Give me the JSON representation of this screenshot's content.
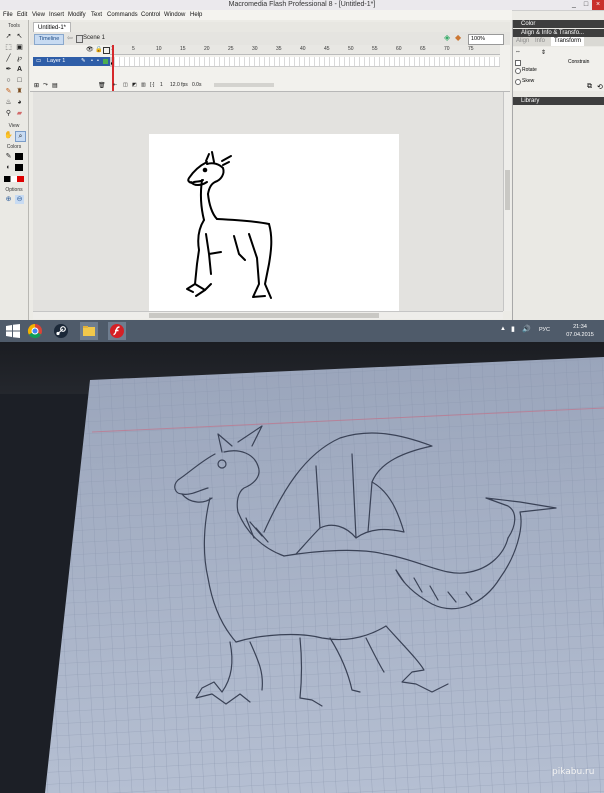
{
  "window": {
    "title": "Macromedia Flash Professional 8 - [Untitled-1*]",
    "controls": [
      "_",
      "□",
      "×"
    ]
  },
  "menubar": {
    "items": [
      "File",
      "Edit",
      "View",
      "Insert",
      "Modify",
      "Text",
      "Commands",
      "Control",
      "Window",
      "Help"
    ]
  },
  "tools": {
    "header": "Tools",
    "view_label": "View",
    "colors_label": "Colors",
    "options_label": "Options",
    "icons": [
      "selection-icon",
      "subselection-icon",
      "free-transform-icon",
      "fill-transform-icon",
      "line-icon",
      "lasso-icon",
      "pen-icon",
      "text-icon",
      "oval-icon",
      "rectangle-icon",
      "pencil-icon",
      "brush-icon",
      "ink-bottle-icon",
      "paint-bucket-icon",
      "eyedropper-icon",
      "eraser-icon",
      "hand-icon",
      "zoom-icon",
      "stroke-color-icon",
      "fill-color-icon",
      "zoom-in-icon",
      "zoom-out-icon"
    ]
  },
  "document": {
    "tab_label": "Untitled-1*",
    "timeline_button": "Timeline",
    "scene_label": "Scene 1",
    "zoom_value": "100%"
  },
  "timeline": {
    "layer_name": "Layer 1",
    "ruler_ticks": [
      "1",
      "5",
      "10",
      "15",
      "20",
      "25",
      "30",
      "35",
      "40",
      "45",
      "50",
      "55",
      "60",
      "65",
      "70",
      "75"
    ],
    "current_frame": "1",
    "frame_rate": "12.0 fps",
    "elapsed_time": "0.0s"
  },
  "panels": {
    "color_header": "Color",
    "align_header": "Align & Info & Transfo...",
    "tabs": [
      "Align",
      "Info",
      "Transform"
    ],
    "constrain_label": "Constrain",
    "rotate_label": "Rotate",
    "skew_label": "Skew",
    "library_header": "Library"
  },
  "taskbar": {
    "icons": [
      "windows-start-icon",
      "chrome-icon",
      "steam-icon",
      "file-explorer-icon",
      "flash-icon"
    ],
    "language": "РУС",
    "time": "21:34",
    "date": "07.04.2015"
  },
  "photo": {
    "watermark": "pikabu.ru",
    "subject": "pencil-dragon-sketch-on-graph-paper"
  },
  "colors": {
    "layer_highlight": "#2f5ea8",
    "playhead": "#d6282b",
    "taskbar": "#4f5b6a",
    "paper": "#a7b2c8",
    "grid_line": "#8793ab",
    "pencil": "#3a4256"
  }
}
